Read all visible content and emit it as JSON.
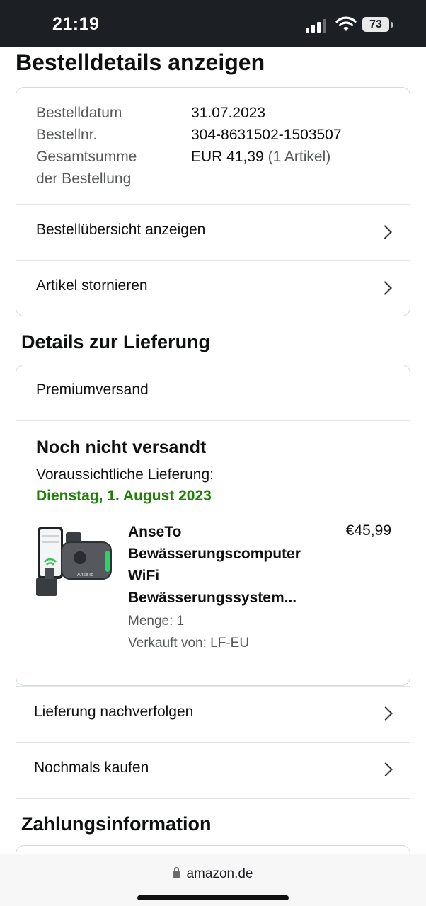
{
  "status_bar": {
    "time": "21:19",
    "battery": "73"
  },
  "page": {
    "title": "Bestelldetails anzeigen"
  },
  "order_summary": {
    "date_label": "Bestelldatum",
    "date_value": "31.07.2023",
    "number_label": "Bestellnr.",
    "number_value": "304-8631502-1503507",
    "total_label_line1": "Gesamtsumme",
    "total_label_line2": "der Bestellung",
    "total_value": "EUR 41,39",
    "total_items": "(1 Artikel)",
    "rows": [
      {
        "label": "Bestellübersicht anzeigen"
      },
      {
        "label": "Artikel stornieren"
      }
    ]
  },
  "delivery": {
    "section_title": "Details zur Lieferung",
    "shipping_method": "Premiumversand",
    "status": "Noch nicht versandt",
    "expected_label": "Voraussichtliche Lieferung:",
    "expected_date": "Dienstag, 1. August 2023",
    "product": {
      "title_lines": [
        "AnseTo",
        "Bewässerungscomputer",
        "WiFi",
        "Bewässerungssystem..."
      ],
      "price": "€45,99",
      "quantity": "Menge: 1",
      "seller": "Verkauft von: LF-EU",
      "image_brand": "AnseTo"
    },
    "rows": [
      {
        "label": "Lieferung nachverfolgen"
      },
      {
        "label": "Nochmals kaufen"
      }
    ]
  },
  "payment": {
    "section_title": "Zahlungsinformation"
  },
  "browser": {
    "url": "amazon.de"
  },
  "colors": {
    "accent_green": "#1d8102",
    "text": "#0f1111",
    "muted": "#565959",
    "border": "#d5d9d9"
  }
}
